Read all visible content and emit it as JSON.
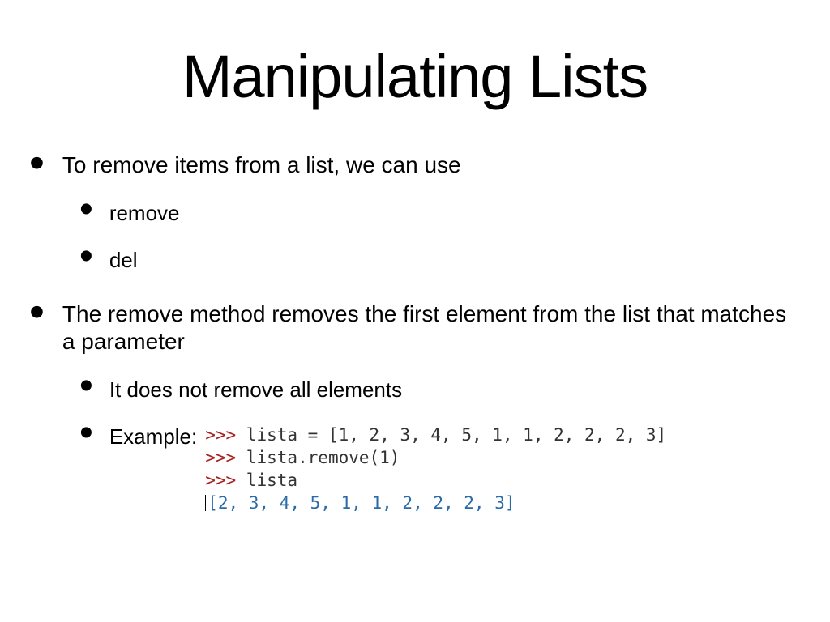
{
  "title": "Manipulating Lists",
  "bullets": {
    "b1_text": "To remove items from a list, we can use",
    "sub1": "remove",
    "sub2": "del",
    "b2_text": "The remove method removes the first element from the list that matches a parameter",
    "sub3": "It does not remove all elements",
    "example_label": "Example:"
  },
  "code": {
    "prompt": ">>>",
    "line1_var": "lista",
    "line1_eq": " = ",
    "line1_list": "[1, 2, 3, 4, 5, 1, 1, 2, 2, 2, 3]",
    "line2": "lista.remove(1)",
    "line3": "lista",
    "result": "[2, 3, 4, 5, 1, 1, 2, 2, 2, 3]"
  }
}
